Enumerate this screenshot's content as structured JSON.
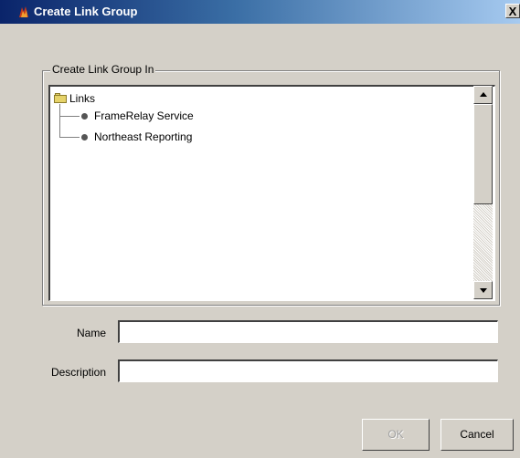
{
  "window": {
    "title": "Create Link Group",
    "close_label": "X",
    "title_icon": "app-flame-icon"
  },
  "group": {
    "label": "Create Link Group In"
  },
  "tree": {
    "root": {
      "label": "Links",
      "icon": "folder-icon"
    },
    "children": [
      {
        "label": "FrameRelay Service",
        "icon": "node-bullet-icon"
      },
      {
        "label": "Northeast Reporting",
        "icon": "node-bullet-icon"
      }
    ]
  },
  "form": {
    "name_label": "Name",
    "name_value": "",
    "description_label": "Description",
    "description_value": ""
  },
  "buttons": {
    "ok": "OK",
    "ok_enabled": false,
    "cancel": "Cancel"
  }
}
